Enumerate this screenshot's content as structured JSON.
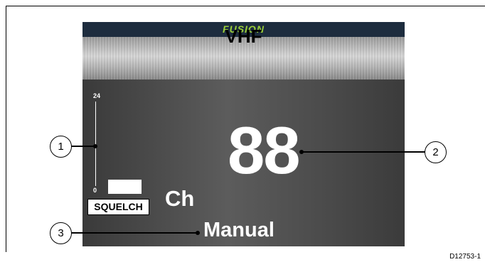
{
  "device": {
    "brand": "FUSION",
    "source_title": "VHF",
    "squelch": {
      "label": "SQUELCH",
      "scale_max": "24",
      "scale_min": "0"
    },
    "channel_prefix": "Ch",
    "channel_number": "88",
    "mode": "Manual"
  },
  "callouts": [
    "1",
    "2",
    "3"
  ],
  "figure_id": "D12753-1",
  "colors": {
    "topbar": "#1d2c3e",
    "brand": "#9bd03a",
    "screen_background": "#4b4b4b",
    "text": "#ffffff"
  }
}
